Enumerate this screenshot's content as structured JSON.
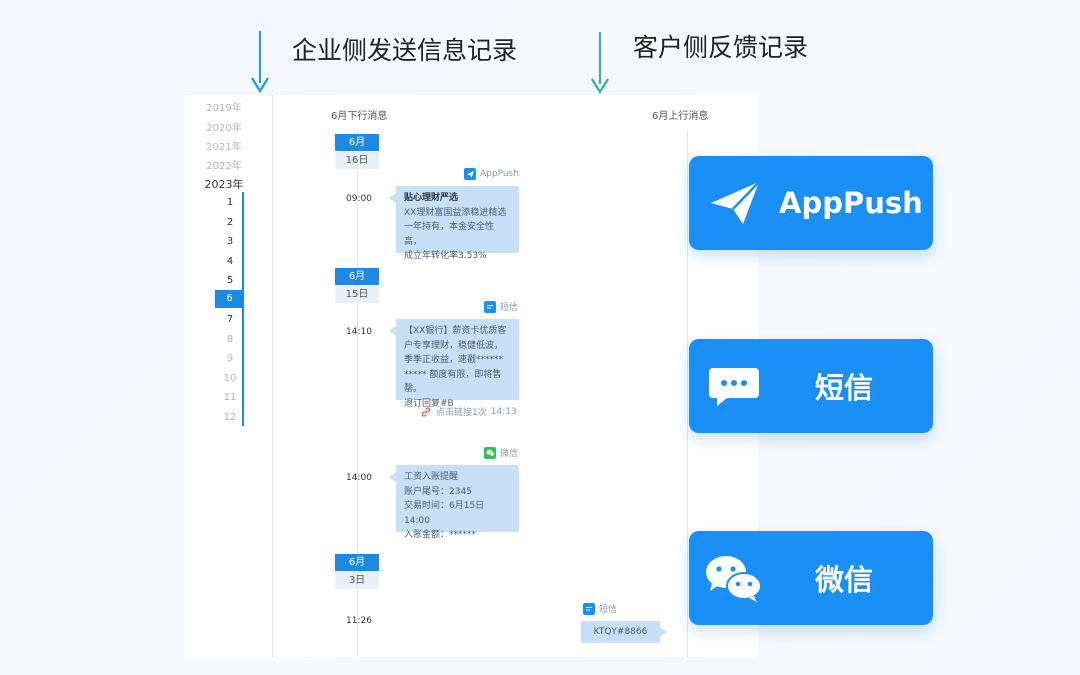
{
  "header": {
    "left_title": "企业侧发送信息记录",
    "right_title": "客户侧反馈记录",
    "left_arrow_color": "#2196f3",
    "right_arrow_color": "#26b5a6"
  },
  "years": [
    "2019年",
    "2020年",
    "2021年",
    "2022年",
    "2023年"
  ],
  "active_year": "2023年",
  "months": [
    "1",
    "2",
    "3",
    "4",
    "5",
    "6",
    "7",
    "8",
    "9",
    "10",
    "11",
    "12"
  ],
  "selected_month": "6",
  "columns": {
    "down": "6月下行消息",
    "up": "6月上行消息"
  },
  "dates": [
    {
      "month": "6月",
      "day": "16日"
    },
    {
      "month": "6月",
      "day": "15日"
    },
    {
      "month": "6月",
      "day": "3日"
    }
  ],
  "messages": [
    {
      "time": "09:00",
      "channel": "AppPush",
      "channel_icon": "paper-plane-icon",
      "title": "贴心理财严选",
      "lines": [
        "XX理财富国益添稳进精选",
        "一年持有，本金安全性高，",
        "成立年转化率3.53%"
      ]
    },
    {
      "time": "14:10",
      "channel": "短信",
      "channel_icon": "sms-icon",
      "lines": [
        "【XX银行】薪资卡优质客",
        "户专享理财，稳健低波，",
        "季季正收益，速戳******",
        "***** 额度有限，即将售罄。",
        "退订回复#B"
      ],
      "link_note": "点击链接1次",
      "link_time": "14:13"
    },
    {
      "time": "14:00",
      "channel": "微信",
      "channel_icon": "wechat-icon",
      "lines": [
        "工资入账提醒",
        "账户尾号：2345",
        "交易时间：6月15日 14:00",
        "入账金额：******"
      ]
    }
  ],
  "reply": {
    "time": "11:26",
    "channel": "短信",
    "channel_icon": "sms-icon",
    "text": "KTQY#8866"
  },
  "cards": [
    {
      "label": "AppPush",
      "icon": "paper-plane-icon"
    },
    {
      "label": "短信",
      "icon": "chat-bubble-icon"
    },
    {
      "label": "微信",
      "icon": "wechat-icon"
    }
  ],
  "colors": {
    "primary": "#1a8ff6",
    "date_badge": "#1e88e5",
    "bubble": "#c8e0f7",
    "wechat_green": "#2ec25b",
    "link_red": "#e4564b"
  }
}
